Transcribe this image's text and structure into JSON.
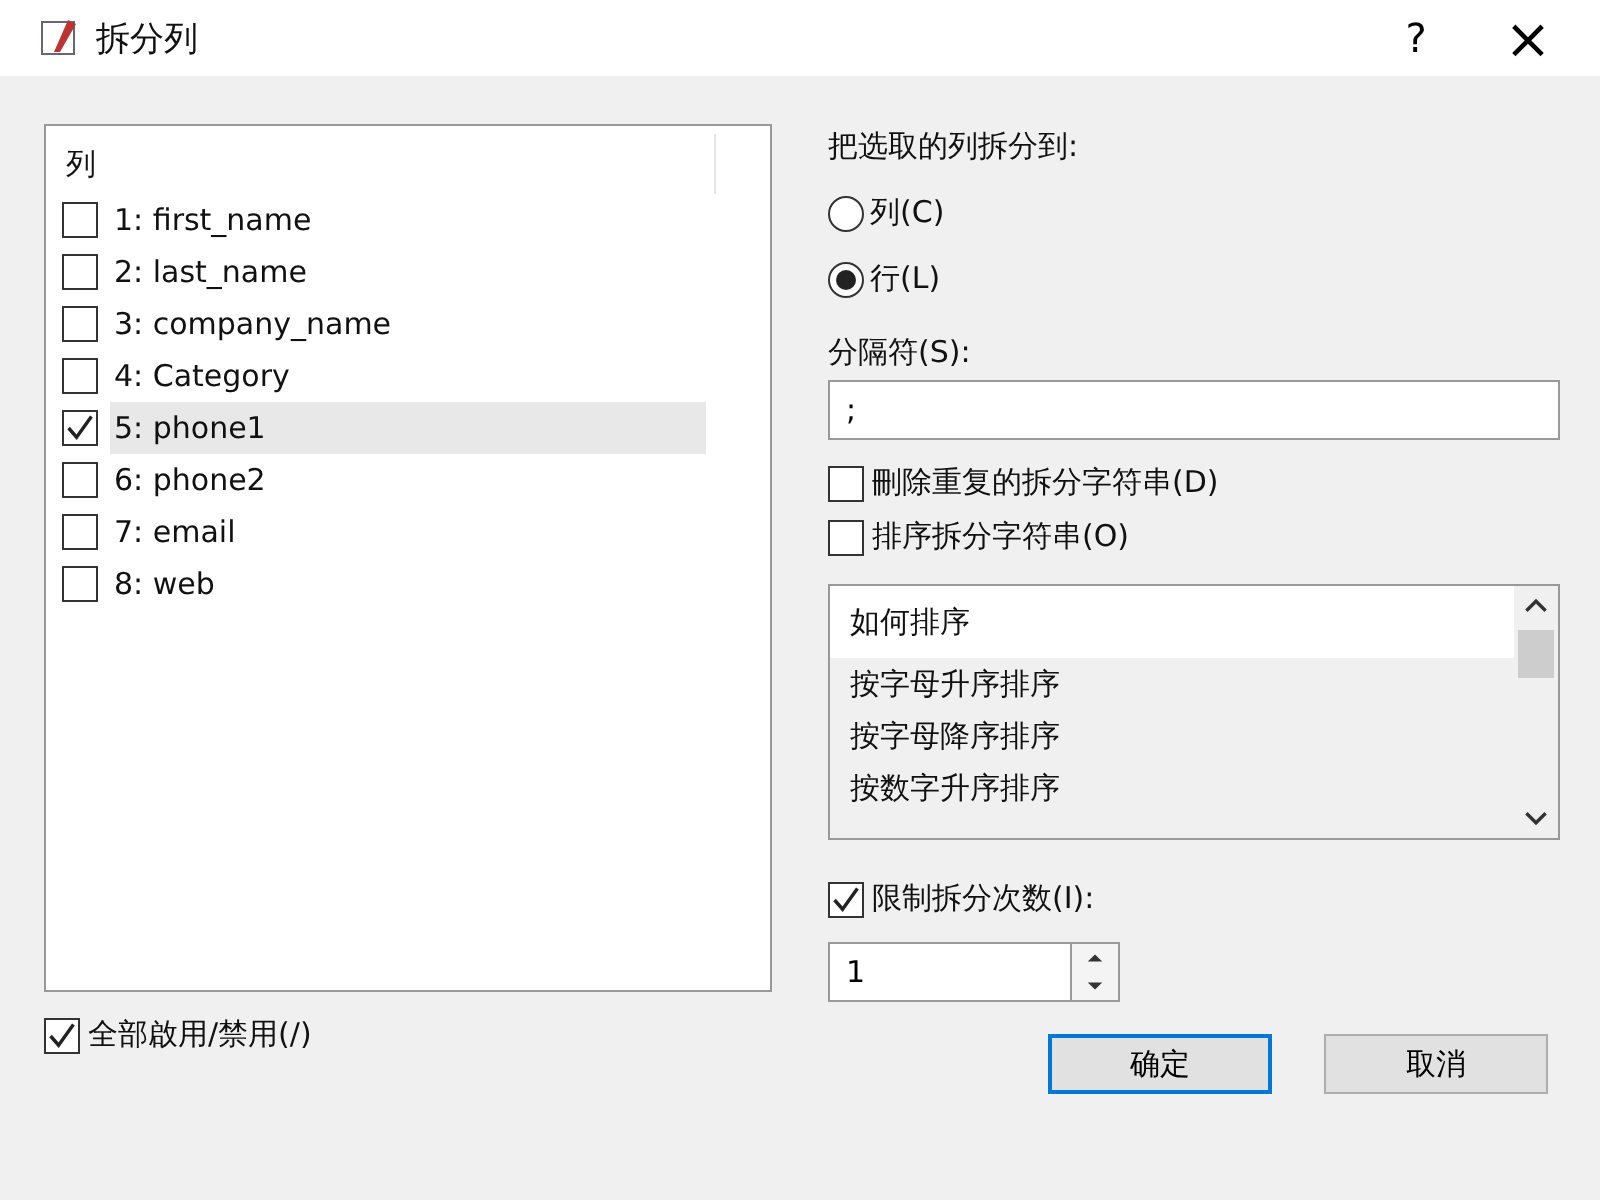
{
  "window": {
    "title": "拆分列",
    "help": "?",
    "close": "×"
  },
  "columns_list": {
    "header": "列",
    "items": [
      {
        "label": "1: first_name",
        "checked": false,
        "selected": false
      },
      {
        "label": "2: last_name",
        "checked": false,
        "selected": false
      },
      {
        "label": "3: company_name",
        "checked": false,
        "selected": false
      },
      {
        "label": "4: Category",
        "checked": false,
        "selected": false
      },
      {
        "label": "5: phone1",
        "checked": true,
        "selected": true
      },
      {
        "label": "6: phone2",
        "checked": false,
        "selected": false
      },
      {
        "label": "7: email",
        "checked": false,
        "selected": false
      },
      {
        "label": "8: web",
        "checked": false,
        "selected": false
      }
    ]
  },
  "toggle_all": {
    "label": "全部啟用/禁用(/)",
    "checked": true
  },
  "split_to": {
    "label": "把选取的列拆分到:",
    "options": [
      {
        "label": "列(C)",
        "selected": false
      },
      {
        "label": "行(L)",
        "selected": true
      }
    ]
  },
  "separator": {
    "label": "分隔符(S):",
    "value": ";"
  },
  "options": [
    {
      "label": "刪除重复的拆分字符串(D)",
      "checked": false
    },
    {
      "label": "排序拆分字符串(O)",
      "checked": false
    }
  ],
  "sort_list": {
    "header": "如何排序",
    "items": [
      "按字母升序排序",
      "按字母降序排序",
      "按数字升序排序"
    ]
  },
  "limit": {
    "label": "限制拆分次数(I):",
    "checked": true,
    "value": "1"
  },
  "buttons": [
    {
      "label": "确定",
      "kind": "default"
    },
    {
      "label": "取消",
      "kind": "normal"
    }
  ]
}
